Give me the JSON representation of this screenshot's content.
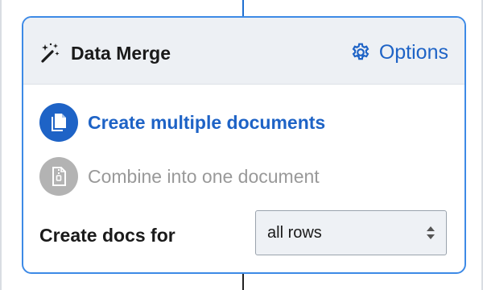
{
  "panel": {
    "title": "Data Merge",
    "title_icon": "magic-wand-icon",
    "options_label": "Options",
    "options_icon": "gear-icon"
  },
  "output_modes": [
    {
      "label": "Create multiple documents",
      "icon": "copy-documents-icon",
      "selected": true
    },
    {
      "label": "Combine into one document",
      "icon": "zip-file-icon",
      "selected": false
    }
  ],
  "create_docs": {
    "label": "Create docs for",
    "selected_value": "all rows"
  },
  "colors": {
    "accent": "#1e63c6",
    "card_border": "#3d8ae6",
    "header_bg": "#edf0f4",
    "inactive": "#b3b3b3",
    "inactive_text": "#999999"
  }
}
